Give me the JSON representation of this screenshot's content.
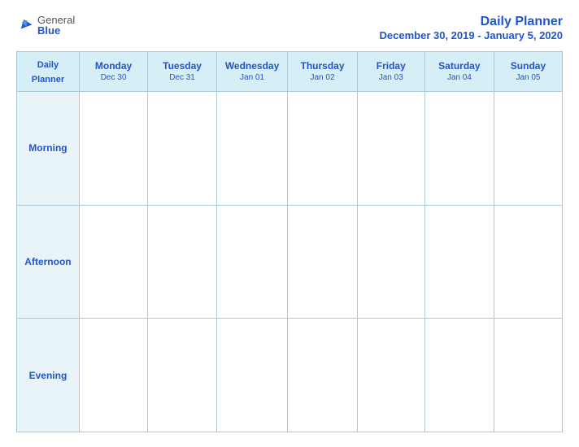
{
  "header": {
    "logo_general": "General",
    "logo_blue": "Blue",
    "title": "Daily Planner",
    "subtitle": "December 30, 2019 - January 5, 2020"
  },
  "table": {
    "label_header": "Daily\nPlanner",
    "columns": [
      {
        "day": "Monday",
        "date": "Dec 30"
      },
      {
        "day": "Tuesday",
        "date": "Dec 31"
      },
      {
        "day": "Wednesday",
        "date": "Jan 01"
      },
      {
        "day": "Thursday",
        "date": "Jan 02"
      },
      {
        "day": "Friday",
        "date": "Jan 03"
      },
      {
        "day": "Saturday",
        "date": "Jan 04"
      },
      {
        "day": "Sunday",
        "date": "Jan 05"
      }
    ],
    "rows": [
      {
        "label": "Morning"
      },
      {
        "label": "Afternoon"
      },
      {
        "label": "Evening"
      }
    ]
  }
}
